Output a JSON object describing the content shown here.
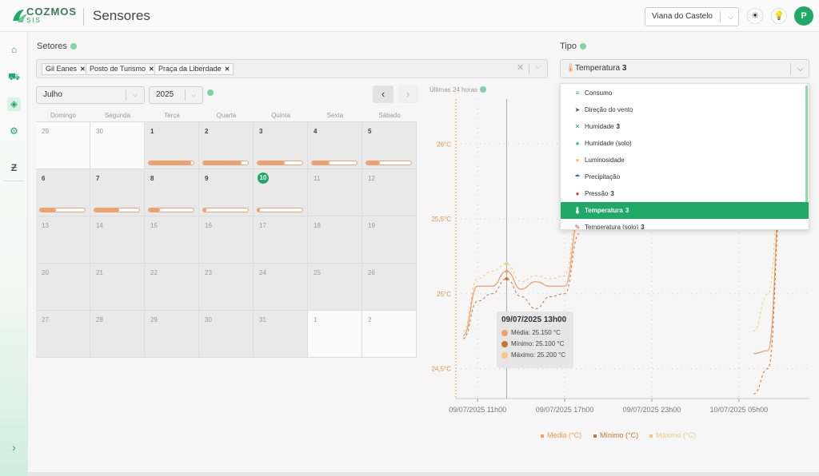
{
  "app": {
    "logo_text": "COZMOS",
    "logo_sub": "SIS",
    "page_title": "Sensores"
  },
  "header": {
    "location": "Viana do Castelo",
    "theme_icon": "sun-icon",
    "hint_icon": "lightbulb-icon",
    "avatar_initial": "P"
  },
  "sidebar": {
    "items": [
      "home-icon",
      "tractor-icon",
      "chip-icon",
      "gear-icon",
      "cozmos-icon"
    ],
    "expand_icon": "chevron-right-icon"
  },
  "setores": {
    "label": "Setores",
    "chips": [
      "Gil Eanes",
      "Posto de Turismo",
      "Praça da Liberdade"
    ]
  },
  "calendar": {
    "month": "Julho",
    "year": "2025",
    "weekdays": [
      "Domingo",
      "Segunda",
      "Terça",
      "Quarta",
      "Quinta",
      "Sexta",
      "Sábado"
    ],
    "days": [
      {
        "n": "29",
        "cur": false
      },
      {
        "n": "30",
        "cur": false
      },
      {
        "n": "1",
        "cur": true,
        "p": 0.95
      },
      {
        "n": "2",
        "cur": true,
        "p": 0.85
      },
      {
        "n": "3",
        "cur": true,
        "p": 0.6
      },
      {
        "n": "4",
        "cur": true,
        "p": 0.4
      },
      {
        "n": "5",
        "cur": true,
        "p": 0.3
      },
      {
        "n": "6",
        "cur": true,
        "p": 0.35
      },
      {
        "n": "7",
        "cur": true,
        "p": 0.55
      },
      {
        "n": "8",
        "cur": true,
        "p": 0.25
      },
      {
        "n": "9",
        "cur": true,
        "p": 0.08
      },
      {
        "n": "10",
        "cur": true,
        "today": true,
        "p": 0.06
      },
      {
        "n": "11",
        "cur": true
      },
      {
        "n": "12",
        "cur": true
      },
      {
        "n": "13",
        "cur": true
      },
      {
        "n": "14",
        "cur": true
      },
      {
        "n": "15",
        "cur": true
      },
      {
        "n": "16",
        "cur": true
      },
      {
        "n": "17",
        "cur": true
      },
      {
        "n": "18",
        "cur": true
      },
      {
        "n": "19",
        "cur": true
      },
      {
        "n": "20",
        "cur": true
      },
      {
        "n": "21",
        "cur": true
      },
      {
        "n": "22",
        "cur": true
      },
      {
        "n": "23",
        "cur": true
      },
      {
        "n": "24",
        "cur": true
      },
      {
        "n": "25",
        "cur": true
      },
      {
        "n": "26",
        "cur": true
      },
      {
        "n": "27",
        "cur": true
      },
      {
        "n": "28",
        "cur": true
      },
      {
        "n": "29",
        "cur": true
      },
      {
        "n": "30",
        "cur": true
      },
      {
        "n": "31",
        "cur": true
      },
      {
        "n": "1",
        "cur": false,
        "next": true
      },
      {
        "n": "2",
        "cur": false,
        "next": true
      }
    ]
  },
  "tipo": {
    "label": "Tipo",
    "selected": "Temperatura",
    "selected_count": "3",
    "options": [
      {
        "label": "Consumo",
        "count": "",
        "icon": "≡",
        "color": "#1fa866"
      },
      {
        "label": "Direção do vento",
        "count": "",
        "icon": "➤",
        "color": "#555"
      },
      {
        "label": "Humidade",
        "count": "3",
        "icon": "✕",
        "color": "#1fa866"
      },
      {
        "label": "Humidade (solo)",
        "count": "",
        "icon": "●",
        "color": "#2dbb7a"
      },
      {
        "label": "Luminosidade",
        "count": "",
        "icon": "●",
        "color": "#f5c15a"
      },
      {
        "label": "Precipitação",
        "count": "",
        "icon": "☂",
        "color": "#2a6fd1"
      },
      {
        "label": "Pressão",
        "count": "3",
        "icon": "●",
        "color": "#d33b2f"
      },
      {
        "label": "Temperatura",
        "count": "3",
        "icon": "🌡",
        "color": "#ffffff",
        "selected": true
      },
      {
        "label": "Temperatura (solo)",
        "count": "3",
        "icon": "✎",
        "color": "#d33b2f"
      }
    ]
  },
  "chart_data": {
    "type": "line",
    "title": "Últimas 24 horas",
    "x": [
      "09/07/2025 10h00",
      "09/07/2025 11h00",
      "09/07/2025 12h00",
      "09/07/2025 13h00",
      "09/07/2025 14h00",
      "09/07/2025 15h00",
      "09/07/2025 16h00",
      "09/07/2025 17h00",
      "09/07/2025 18h00",
      "09/07/2025 19h00",
      "09/07/2025 20h00",
      "09/07/2025 21h00",
      "09/07/2025 22h00",
      "09/07/2025 23h00",
      "10/07/2025 00h00",
      "10/07/2025 01h00",
      "10/07/2025 02h00",
      "10/07/2025 03h00",
      "10/07/2025 04h00",
      "10/07/2025 05h00",
      "10/07/2025 06h00",
      "10/07/2025 07h00",
      "10/07/2025 08h00"
    ],
    "xticks": [
      "09/07/2025 11h00",
      "09/07/2025 17h00",
      "09/07/2025 23h00",
      "10/07/2025 05h00"
    ],
    "yticks": [
      "24,5°C",
      "25°C",
      "25,5°C",
      "26°C"
    ],
    "ylim": [
      24.3,
      26.3
    ],
    "series": [
      {
        "name": "Média (°C)",
        "color": "#f0a06a",
        "values": [
          24.72,
          25.05,
          25.05,
          25.15,
          25.03,
          25.08,
          25.05,
          25.05,
          25.5,
          null,
          null,
          null,
          null,
          null,
          null,
          null,
          null,
          null,
          null,
          null,
          24.6,
          24.62,
          25.8
        ]
      },
      {
        "name": "Mínimo (°C)",
        "color": "#c9742f",
        "values": [
          24.7,
          24.95,
          25.0,
          25.1,
          24.98,
          24.9,
          24.98,
          25.0,
          25.4,
          null,
          null,
          null,
          null,
          null,
          null,
          null,
          null,
          null,
          null,
          null,
          24.33,
          24.5,
          25.7
        ]
      },
      {
        "name": "Máximo (°C)",
        "color": "#f5c77e",
        "values": [
          24.75,
          25.1,
          25.15,
          25.2,
          25.08,
          25.12,
          25.1,
          25.12,
          25.6,
          null,
          null,
          null,
          null,
          null,
          null,
          null,
          null,
          null,
          null,
          null,
          24.75,
          25.0,
          25.9
        ]
      }
    ],
    "tooltip": {
      "title": "09/07/2025 13h00",
      "rows": [
        {
          "label": "Média: 25.150 °C",
          "color": "#f0a06a"
        },
        {
          "label": "Mínimo: 25.100 °C",
          "color": "#c9742f"
        },
        {
          "label": "Máximo: 25.200 °C",
          "color": "#f5c77e"
        }
      ]
    },
    "legend": [
      "Média (°C)",
      "Mínimo (°C)",
      "Máximo (°C)"
    ],
    "legend_position": "bottom",
    "grid": true
  }
}
